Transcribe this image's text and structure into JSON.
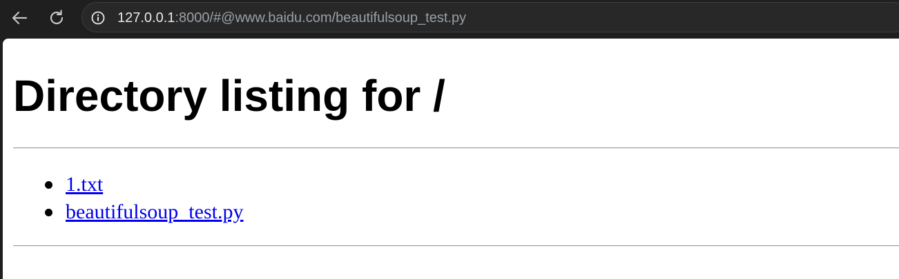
{
  "browser": {
    "address_bar": {
      "url_host": "127.0.0.1",
      "url_rest": ":8000/#@www.baidu.com/beautifulsoup_test.py"
    },
    "icons": {
      "back": "back-arrow-icon",
      "reload": "reload-icon",
      "site_info": "info-icon"
    }
  },
  "page": {
    "heading": "Directory listing for /",
    "files": [
      {
        "name": "1.txt"
      },
      {
        "name": "beautifulsoup_test.py"
      }
    ]
  },
  "colors": {
    "chrome_bg": "#1f1f1f",
    "omnibox_bg": "#282828",
    "link": "#0000ee",
    "page_bg": "#ffffff"
  }
}
